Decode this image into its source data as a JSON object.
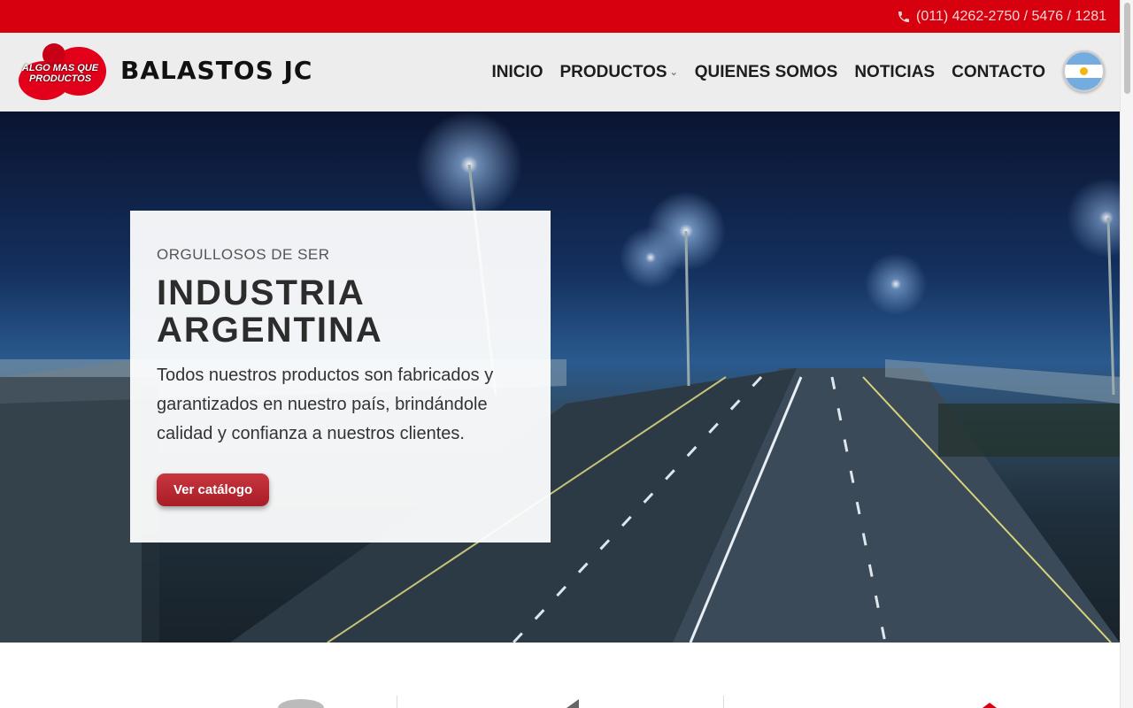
{
  "topbar": {
    "phone_icon": "phone-icon",
    "phone_text": "(011) 4262-2750 / 5476 / 1281",
    "bg_color": "#d7000f"
  },
  "header": {
    "logo_tag": "ALGO MAS QUE PRODUCTOS",
    "logo_text": "BALASTOS JC",
    "nav": [
      {
        "label": "INICIO"
      },
      {
        "label": "PRODUCTOS",
        "has_dropdown": true
      },
      {
        "label": "QUIENES SOMOS"
      },
      {
        "label": "NOTICIAS"
      },
      {
        "label": "CONTACTO"
      }
    ],
    "flag_icon": "argentina-flag-icon"
  },
  "hero": {
    "eyebrow": "ORGULLOSOS DE SER",
    "title_line1": "INDUSTRIA",
    "title_line2": "ARGENTINA",
    "description": "Todos nuestros productos son fabricados y garantizados en nuestro país, brindándole calidad y confianza a nuestros clientes.",
    "button_label": "Ver catálogo",
    "accent_color": "#b3262f"
  }
}
